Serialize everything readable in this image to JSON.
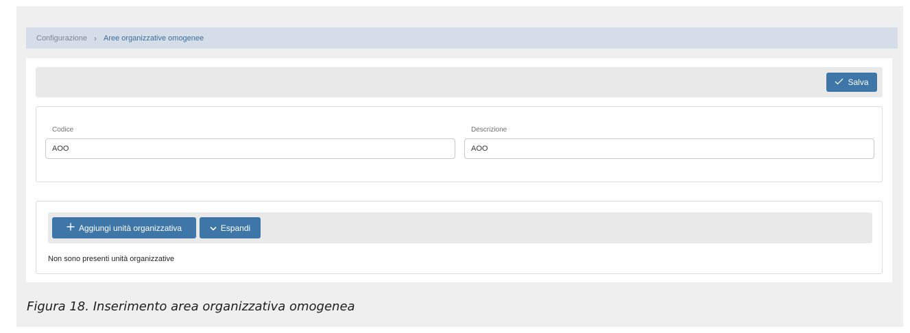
{
  "breadcrumb": {
    "root": "Configurazione",
    "separator": "›",
    "current": "Aree organizzative omogenee"
  },
  "toolbar": {
    "save_label": "Salva",
    "save_icon": "check-icon"
  },
  "form": {
    "codice": {
      "label": "Codice",
      "value": "AOO"
    },
    "descrizione": {
      "label": "Descrizione",
      "value": "AOO"
    }
  },
  "units": {
    "add_label": "Aggiungi unità organizzativa",
    "add_icon": "plus-icon",
    "expand_label": "Espandi",
    "expand_icon": "chevron-down-icon",
    "empty_message": "Non sono presenti unità organizzative"
  },
  "caption": "Figura 18. Inserimento area organizzativa omogenea",
  "colors": {
    "accent": "#3e76a8",
    "breadcrumb_bg": "#d5dee8",
    "toolbar_bg": "#e9e9e9"
  }
}
